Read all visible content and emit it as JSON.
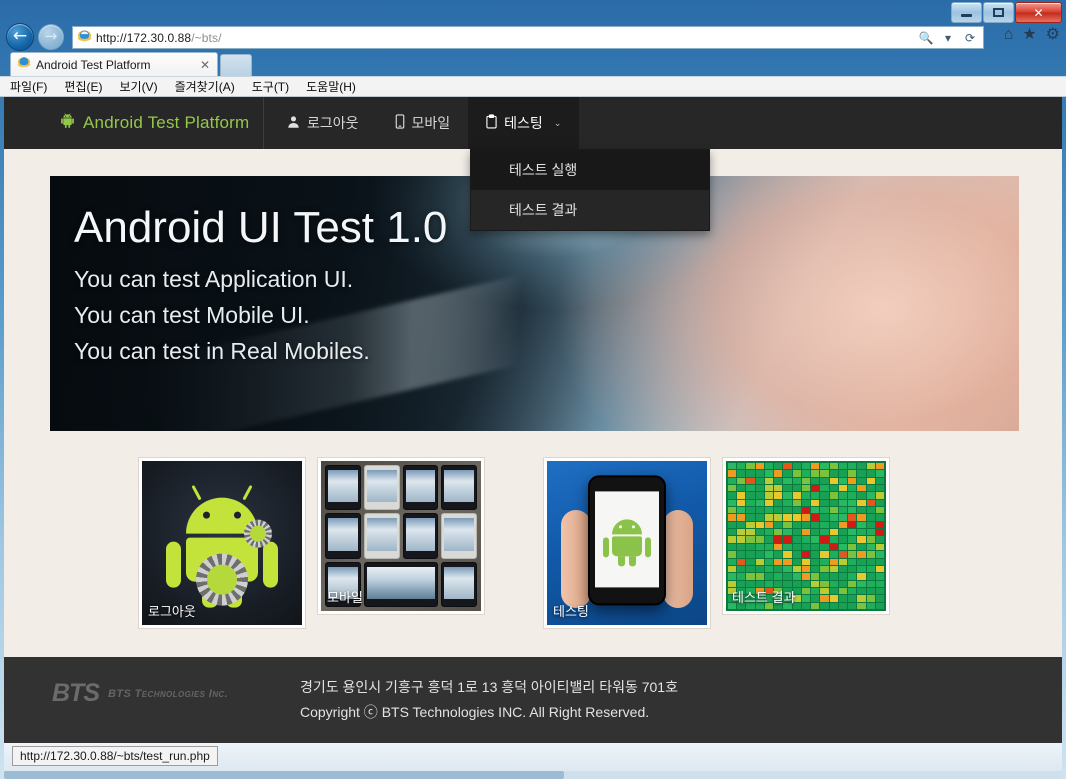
{
  "browser": {
    "window_controls": {
      "minimize": "—",
      "maximize": "❐",
      "close": "✕"
    },
    "back_arrow": "←",
    "forward_arrow": "→",
    "address": {
      "scheme_host": "http://172.30.0.88",
      "path": "/~bts/"
    },
    "address_tools": {
      "search": "🔍",
      "dropdown": "▾",
      "refresh": "⟳"
    },
    "chrome_tools": {
      "home": "⌂",
      "favorites": "★",
      "settings": "⚙"
    },
    "tab": {
      "title": "Android Test Platform",
      "close": "✕"
    },
    "menubar": [
      "파일(F)",
      "편집(E)",
      "보기(V)",
      "즐겨찾기(A)",
      "도구(T)",
      "도움말(H)"
    ],
    "statusbar": {
      "url": "http://172.30.0.88/~bts/test_run.php"
    }
  },
  "site": {
    "brand": {
      "label": "Android Test Platform",
      "color": "#94c84a"
    },
    "nav": [
      {
        "label": "로그아웃",
        "icon": "person-icon",
        "active": false
      },
      {
        "label": "모바일",
        "icon": "mobile-icon",
        "active": false
      },
      {
        "label": "테스팅",
        "icon": "clipboard-icon",
        "active": true,
        "caret": "⌄"
      }
    ],
    "dropdown": {
      "items": [
        {
          "label": "테스트 실행",
          "hovered": true
        },
        {
          "label": "테스트 결과",
          "hovered": false
        }
      ]
    },
    "hero": {
      "title": "Android UI Test 1.0",
      "lines": [
        "You can test Application UI.",
        "You can test Mobile UI.",
        "You can test in Real Mobiles."
      ]
    },
    "cards": [
      {
        "label": "로그아웃",
        "image": "android-robot-gears-image"
      },
      {
        "label": "모바일",
        "image": "many-phones-table-image"
      },
      {
        "label": "테스팅",
        "image": "hand-holding-phone-android-image"
      },
      {
        "label": "테스트 결과",
        "image": "heatmap-grid-image"
      }
    ],
    "footer": {
      "logo_mark": "BTS",
      "logo_name": "BTS Technologies Inc.",
      "address": "경기도 용인시 기흥구 흥덕 1로 13 흥덕 아이티밸리 타워동 701호",
      "copyright": "Copyright ⓒ BTS Technologies INC. All Right Reserved."
    }
  }
}
